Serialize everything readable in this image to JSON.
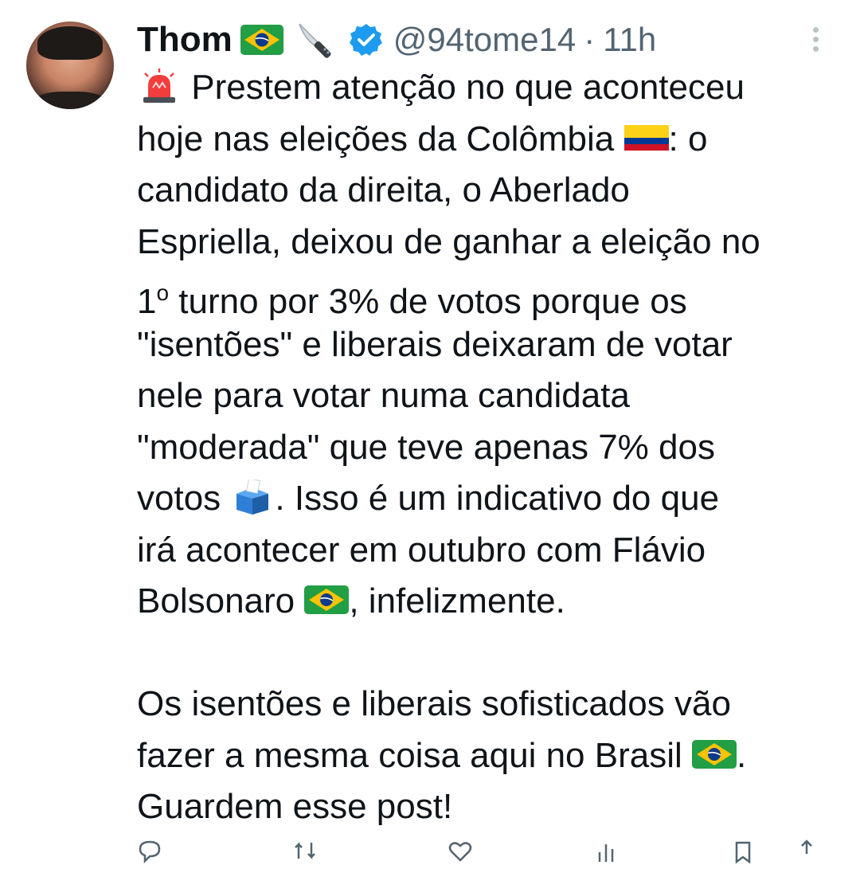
{
  "tweet": {
    "author_name": "Thom",
    "handle": "@94tome14",
    "separator": "·",
    "timestamp": "11h",
    "name_emojis": [
      "brazil-flag-emoji",
      "knife-emoji"
    ],
    "verified_badge_color": "#1d9bf0",
    "text_lines": [
      " Prestem atenção no que aconteceu",
      "hoje nas eleições da Colômbia ",
      ": o",
      "candidato da direita, o Aberlado",
      "Espriella, deixou de ganhar a eleição no",
      "1",
      "o",
      " turno  por 3% de votos porque os",
      "\"isentões\" e liberais deixaram de votar",
      "nele para votar numa candidata",
      "\"moderada\" que teve  apenas 7% dos",
      "votos ",
      ". Isso é um indicativo do que",
      "irá acontecer em outubro com Flávio",
      "Bolsonaro ",
      ", infelizmente.",
      "Os isentões e liberais sofisticados vão",
      "fazer a mesma coisa aqui no Brasil ",
      ".",
      "Guardem esse post!"
    ]
  },
  "colors": {
    "text": "#0f1419",
    "secondary": "#536471",
    "verified": "#1d9bf0",
    "background": "#ffffff"
  }
}
